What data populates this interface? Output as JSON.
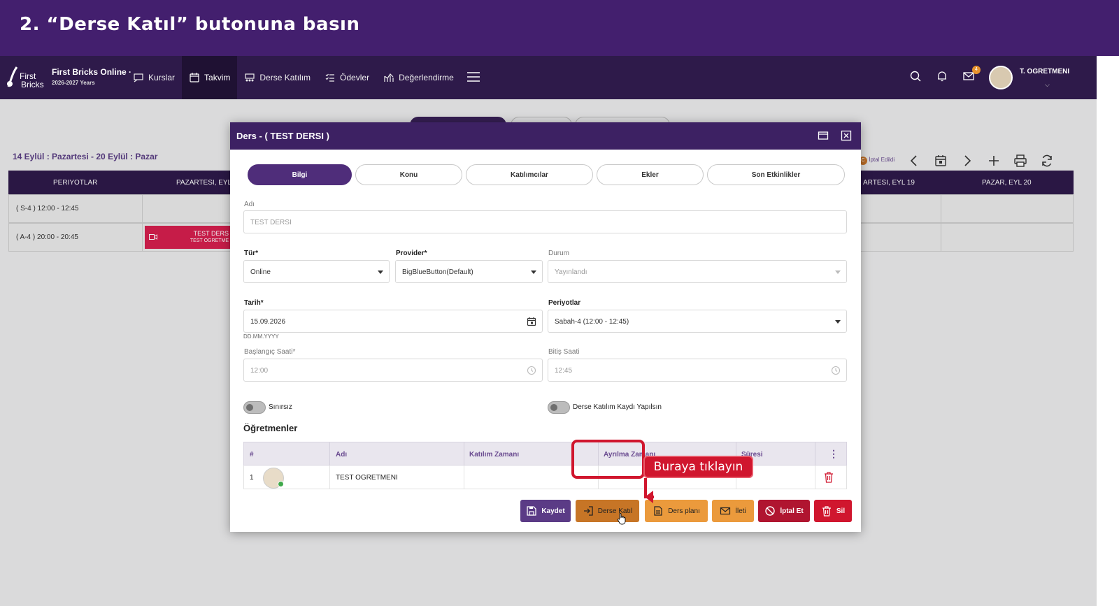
{
  "banner": {
    "title": "2. “Derse Katıl” butonuna basın"
  },
  "nav": {
    "logo_line1": "First",
    "logo_line2": "Bricks",
    "brand": "First Bricks Online ·",
    "brand_sub": "2026-2027 Years",
    "items": [
      {
        "label": "Kurslar",
        "icon": "course-icon"
      },
      {
        "label": "Takvim",
        "icon": "calendar-icon",
        "active": true
      },
      {
        "label": "Derse Katılım",
        "icon": "attendance-icon"
      },
      {
        "label": "Ödevler",
        "icon": "checklist-icon"
      },
      {
        "label": "Değerlendirme",
        "icon": "chart-icon"
      }
    ],
    "mail_badge": "4",
    "user_name": "T. OGRETMENI"
  },
  "calendar": {
    "range": "14 Eylül : Pazartesi - 20 Eylül : Pazar",
    "cancelled_badge": "C",
    "cancelled_label": "İptal Edildi",
    "headers": [
      "PERIYOTLAR",
      "PAZARTESI, EYL",
      "ARTESI, EYL 19",
      "PAZAR, EYL 20"
    ],
    "rows": [
      "( S-4 ) 12:00 - 12:45",
      "( A-4 ) 20:00 - 20:45"
    ],
    "event_title": "TEST DERS",
    "event_sub": "TEST OGRETME"
  },
  "modal": {
    "title": "Ders - ( TEST DERSI )",
    "tabs": [
      "Bilgi",
      "Konu",
      "Katılımcılar",
      "Ekler",
      "Son Etkinlikler"
    ],
    "name_label": "Adı",
    "name_value": "TEST DERSI",
    "type_label": "Tür*",
    "type_value": "Online",
    "provider_label": "Provider*",
    "provider_value": "BigBlueButton(Default)",
    "status_label": "Durum",
    "status_value": "Yayınlandı",
    "date_label": "Tarih*",
    "date_value": "15.09.2026",
    "date_hint": "DD.MM.YYYY",
    "periods_label": "Periyotlar",
    "periods_value": "Sabah-4 (12:00 - 12:45)",
    "start_label": "Başlangıç Saati*",
    "start_value": "12:00",
    "end_label": "Bitiş Saati",
    "end_value": "12:45",
    "unlimited_label": "Sınırsız",
    "attendance_label": "Derse Katılım Kaydı Yapılsın",
    "teachers_title": "Öğretmenler",
    "table_headers": [
      "#",
      "Adı",
      "Katılım Zamanı",
      "Ayrılma Zamanı",
      "Süresi"
    ],
    "table_rows": [
      {
        "num": "1",
        "name": "TEST OGRETMENI"
      }
    ],
    "buttons": {
      "save": "Kaydet",
      "join": "Derse Katıl",
      "plan": "Ders planı",
      "message": "İleti",
      "cancel": "İptal Et",
      "delete": "Sil"
    }
  },
  "callout": {
    "text": "Buraya tıklayın"
  },
  "colors": {
    "banner": "#431f6e",
    "nav": "#2e1a4a",
    "save": "#5b3b86",
    "join": "#c77526",
    "plan": "#eb9a3c",
    "message": "#eb9a3c",
    "cancel": "#b01530",
    "delete": "#d0162e",
    "callout": "#d0162e"
  }
}
